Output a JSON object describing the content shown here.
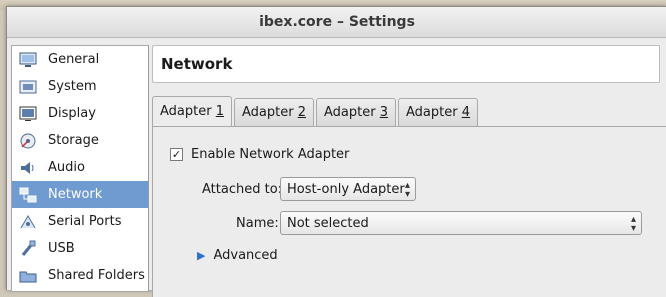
{
  "window": {
    "title": "ibex.core – Settings"
  },
  "sidebar": {
    "items": [
      {
        "label": "General",
        "icon": "general-icon"
      },
      {
        "label": "System",
        "icon": "system-icon"
      },
      {
        "label": "Display",
        "icon": "display-icon"
      },
      {
        "label": "Storage",
        "icon": "storage-icon"
      },
      {
        "label": "Audio",
        "icon": "audio-icon"
      },
      {
        "label": "Network",
        "icon": "network-icon",
        "selected": true
      },
      {
        "label": "Serial Ports",
        "icon": "serial-ports-icon"
      },
      {
        "label": "USB",
        "icon": "usb-icon"
      },
      {
        "label": "Shared Folders",
        "icon": "shared-folders-icon"
      }
    ]
  },
  "page": {
    "title": "Network"
  },
  "tabs": [
    {
      "prefix": "Adapter ",
      "accel": "1",
      "active": true
    },
    {
      "prefix": "Adapter ",
      "accel": "2"
    },
    {
      "prefix": "Adapter ",
      "accel": "3"
    },
    {
      "prefix": "Adapter ",
      "accel": "4"
    }
  ],
  "adapter": {
    "enable_label": "Enable Network Adapter",
    "enable_checked": true,
    "attached_label": "Attached to:",
    "attached_value": "Host-only Adapter",
    "name_label": "Name:",
    "name_value": "Not selected",
    "advanced_label": "Advanced"
  },
  "colors": {
    "selection": "#6f9bd1",
    "expander": "#2f6fcf"
  }
}
